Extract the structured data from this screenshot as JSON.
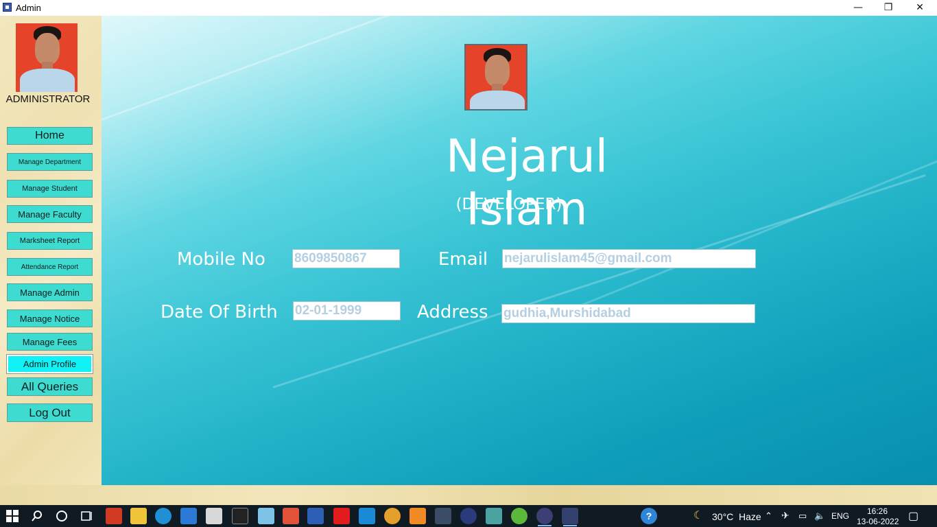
{
  "window": {
    "title": "Admin",
    "minimize": "—",
    "maximize": "❐",
    "close": "✕"
  },
  "sidebar": {
    "role_label": "ADMINISTRATOR",
    "items": [
      {
        "label": "Home"
      },
      {
        "label": "Manage Department"
      },
      {
        "label": "Manage Student"
      },
      {
        "label": "Manage Faculty"
      },
      {
        "label": "Marksheet Report"
      },
      {
        "label": "Attendance Report"
      },
      {
        "label": "Manage Admin"
      },
      {
        "label": "Manage Notice"
      },
      {
        "label": "Manage Fees"
      },
      {
        "label": "Admin Profile",
        "active": true
      },
      {
        "label": "All Queries"
      },
      {
        "label": "Log Out"
      }
    ]
  },
  "profile": {
    "name": "Nejarul Islam",
    "role": "(DEVELOPER)",
    "mobile_label": "Mobile No",
    "mobile_value": "8609850867",
    "email_label": "Email",
    "email_value": "nejarulislam45@gmail.com",
    "dob_label": "Date Of Birth",
    "dob_value": "02-01-1999",
    "address_label": "Address",
    "address_value": "gudhia,Murshidabad"
  },
  "taskbar": {
    "weather_temp": "30°C",
    "weather_desc": "Haze",
    "language": "ENG",
    "time": "16:26",
    "date": "13-06-2022",
    "pinned_icons": [
      "windows-start-icon",
      "search-icon",
      "cortana-icon",
      "task-view-icon",
      "office-icon",
      "file-explorer-icon",
      "edge-icon",
      "remote-desktop-icon",
      "mail-icon",
      "terminal-icon",
      "notepad-icon",
      "office-app-icon",
      "word-icon",
      "youtube-icon",
      "vscode-icon",
      "chrome-icon",
      "xampp-icon",
      "sql-icon",
      "eclipse-icon",
      "settings-icon",
      "utorrent-icon",
      "netbeans-icon",
      "java-app-icon"
    ]
  },
  "colors": {
    "nav_button": "#3edcd0",
    "nav_button_active": "#10f2f5",
    "field_text": "#b5cfe0",
    "taskbar": "#101a22"
  }
}
